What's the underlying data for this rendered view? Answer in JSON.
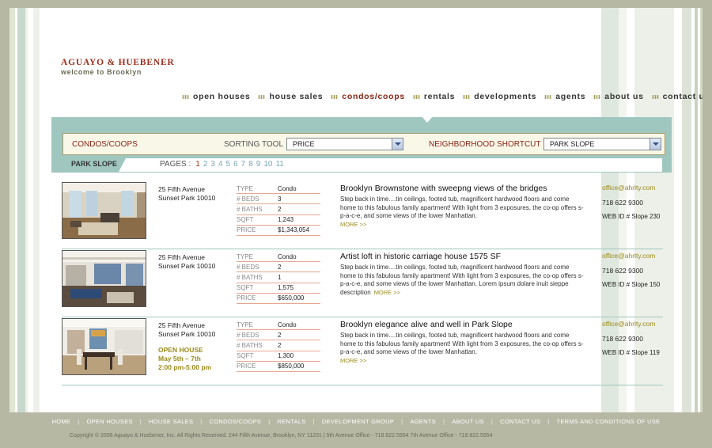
{
  "brand": {
    "name": "AGUAYO & HUEBENER",
    "tagline": "welcome to Brooklyn",
    "accent": "#9c2e1c",
    "band_color": "#9fc7bf",
    "gold": "#9a8a1a"
  },
  "nav": [
    {
      "label": "open houses"
    },
    {
      "label": "house sales"
    },
    {
      "label": "condos/coops"
    },
    {
      "label": "rentals"
    },
    {
      "label": "developments"
    },
    {
      "label": "agents"
    },
    {
      "label": "about us"
    },
    {
      "label": "contact us"
    }
  ],
  "search": {
    "category": "CONDOS/COOPS",
    "sort_label": "SORTING TOOL",
    "sort_value": "PRICE",
    "hood_label": "NEIGHBORHOOD SHORTCUT",
    "hood_value": "PARK SLOPE",
    "current_hood": "PARK SLOPE"
  },
  "pagination": {
    "label": "PAGES :",
    "pages": [
      "1",
      "2",
      "3",
      "4",
      "5",
      "6",
      "7",
      "8",
      "9",
      "10",
      "11"
    ]
  },
  "listings": [
    {
      "address1": "25 Fifth Avenue",
      "address2": "Sunset Park 10010",
      "open_title": "",
      "open_dates": "",
      "open_time": "",
      "specs": [
        {
          "k": "TYPE",
          "v": "Condo"
        },
        {
          "k": "# BEDS",
          "v": "3"
        },
        {
          "k": "# BATHS",
          "v": "2"
        },
        {
          "k": "SQFT",
          "v": "1,243"
        },
        {
          "k": "PRICE",
          "v": "$1,343,054"
        }
      ],
      "title": "Brooklyn Brownstone with sweepng views of the bridges",
      "body": "Step back in time....tin ceilings, footed tub, magnificent hardwood floors and come home to this fabulous family apartment! With light from 3 exposures, the co-op offers s-p-a-c-e, and some views of the lower Manhattan.",
      "more": "MORE  >>",
      "email": "office@ahrlty.com",
      "phone": "718 622 9300",
      "webid": "WEB ID # Slope 230"
    },
    {
      "address1": "25 Fifth Avenue",
      "address2": "Sunset Park 10010",
      "open_title": "",
      "open_dates": "",
      "open_time": "",
      "specs": [
        {
          "k": "TYPE",
          "v": "Condo"
        },
        {
          "k": "# BEDS",
          "v": "2"
        },
        {
          "k": "# BATHS",
          "v": "1"
        },
        {
          "k": "SQFT",
          "v": "1,575"
        },
        {
          "k": "PRICE",
          "v": "$650,000"
        }
      ],
      "title": "Artist loft in historic carriage house 1575 SF",
      "body": "Step back in time....tin ceilings, footed tub, magnificent hardwood floors and come home to this fabulous family apartment! With light from 3 exposures, the co-op offers s-p-a-c-e, and some views of the lower Manhattan. Lorem ipsum dolare inuit sieppe description",
      "more": "MORE  >>",
      "email": "office@ahrlty.com",
      "phone": "718 622 9300",
      "webid": "WEB ID # Slope 150"
    },
    {
      "address1": "25 Fifth Avenue",
      "address2": "Sunset Park 10010",
      "open_title": "OPEN HOUSE",
      "open_dates": "May 5th – 7th",
      "open_time": "2:00 pm-5:00 pm",
      "specs": [
        {
          "k": "TYPE",
          "v": "Condo"
        },
        {
          "k": "# BEDS",
          "v": "2"
        },
        {
          "k": "# BATHS",
          "v": "2"
        },
        {
          "k": "SQFT",
          "v": "1,300"
        },
        {
          "k": "PRICE",
          "v": "$850,000"
        }
      ],
      "title": "Brooklyn elegance alive and well in Park Slope",
      "body": "Step back in time....tin ceilings, footed tub, magnificent hardwood floors and come home to this fabulous family apartment! With light from 3 exposures, the co-op offers s-p-a-c-e, and some views of the lower Manhattan.",
      "more": "MORE  >>",
      "email": "office@ahrlty.com",
      "phone": "718 622 9300",
      "webid": "WEB ID # Slope 119"
    }
  ],
  "footer": {
    "links": [
      "HOME",
      "OPEN HOUSES",
      "HOUSE SALES",
      "CONDOS/COOPS",
      "RENTALS",
      "DEVELOPMENT GROUP",
      "AGENTS",
      "ABOUT US",
      "CONTACT US",
      "TERMS AND CONDITIONS OF USE"
    ],
    "separator": "|",
    "copyright": "Copyright © 2006 Aguayo & Huebener, Inc. All Rights Reserved. 244 Fifth Avenue, Brooklyn, NY 11201 | 5th Avenue Office - 718.822.5954  7th Avenue Office - 718.822.5954"
  }
}
